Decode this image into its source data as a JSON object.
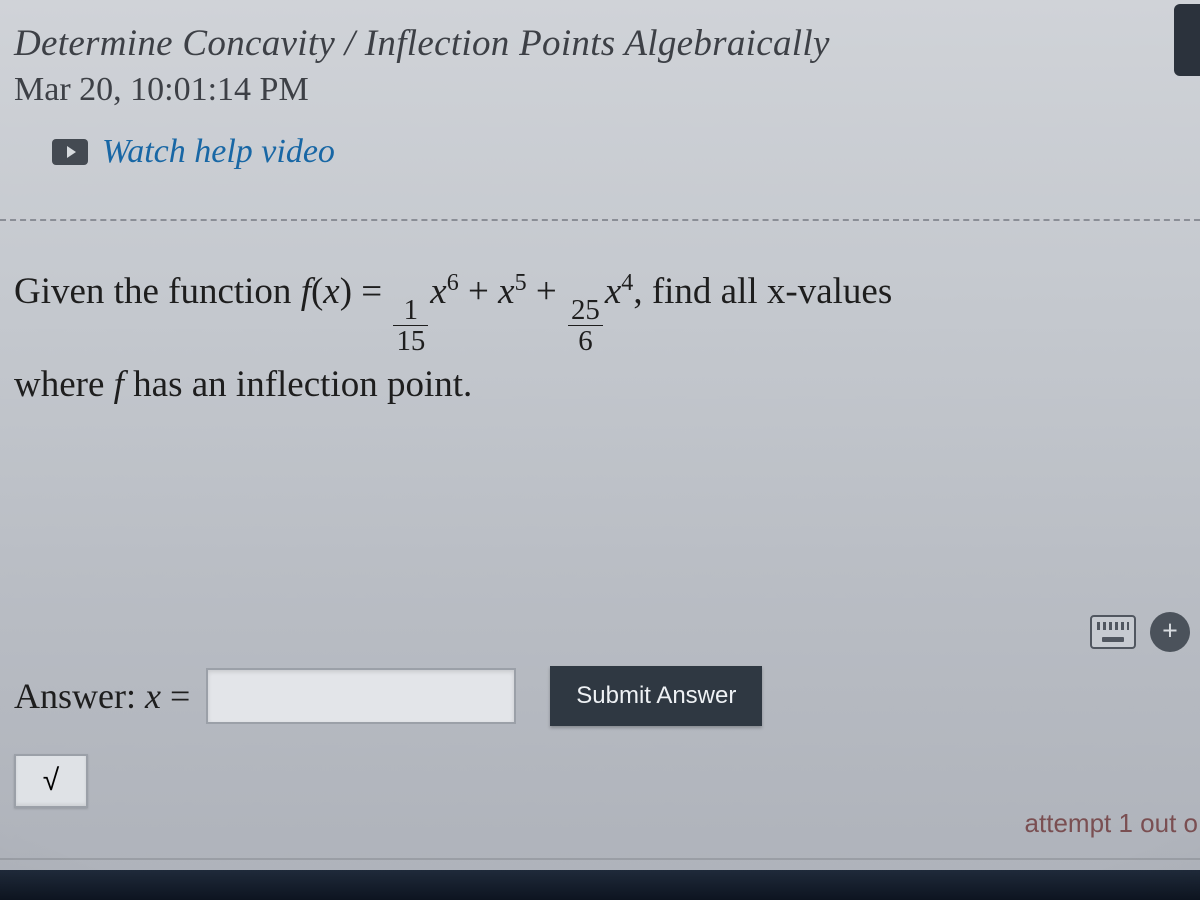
{
  "header": {
    "title": "Determine Concavity / Inflection Points Algebraically",
    "timestamp": "Mar 20, 10:01:14 PM",
    "watch_label": "Watch help video"
  },
  "problem": {
    "lead": "Given the function ",
    "tail": ", find all x-values",
    "line2_pre": "where ",
    "line2_post": " has an inflection point.",
    "function": {
      "frac1_num": "1",
      "frac1_den": "15",
      "exp1": "6",
      "exp2": "5",
      "frac2_num": "25",
      "frac2_den": "6",
      "exp3": "4"
    }
  },
  "answer": {
    "label_prefix": "Answer:",
    "submit_label": "Submit Answer",
    "sqrt_symbol": "√",
    "plus_symbol": "+",
    "input_value": ""
  },
  "footer": {
    "attempt_text": "attempt 1 out o"
  }
}
